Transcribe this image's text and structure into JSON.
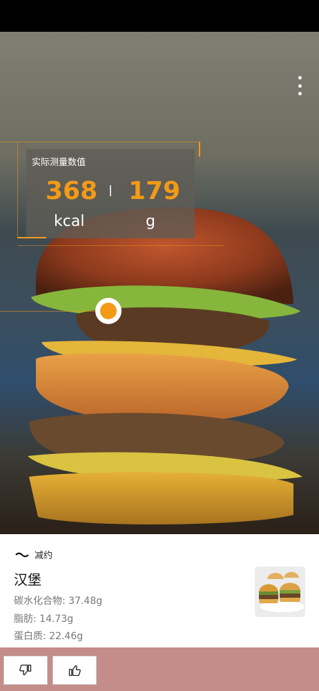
{
  "measure_panel": {
    "title": "实际测量数值",
    "calories_value": "368",
    "calories_unit": "kcal",
    "weight_value": "179",
    "weight_unit": "g"
  },
  "info_card": {
    "brand_label": "减约",
    "food_name": "汉堡",
    "nutrients": [
      "碳水化合物: 37.48g",
      "脂肪: 14.73g",
      "蛋白质: 22.46g"
    ]
  },
  "icons": {
    "menu": "more-vertical-icon",
    "brand": "brand-logo-icon",
    "dislike": "thumbs-down-icon",
    "like": "thumbs-up-icon"
  },
  "colors": {
    "accent": "#f39a17",
    "bottom_bar": "#c48d89"
  }
}
